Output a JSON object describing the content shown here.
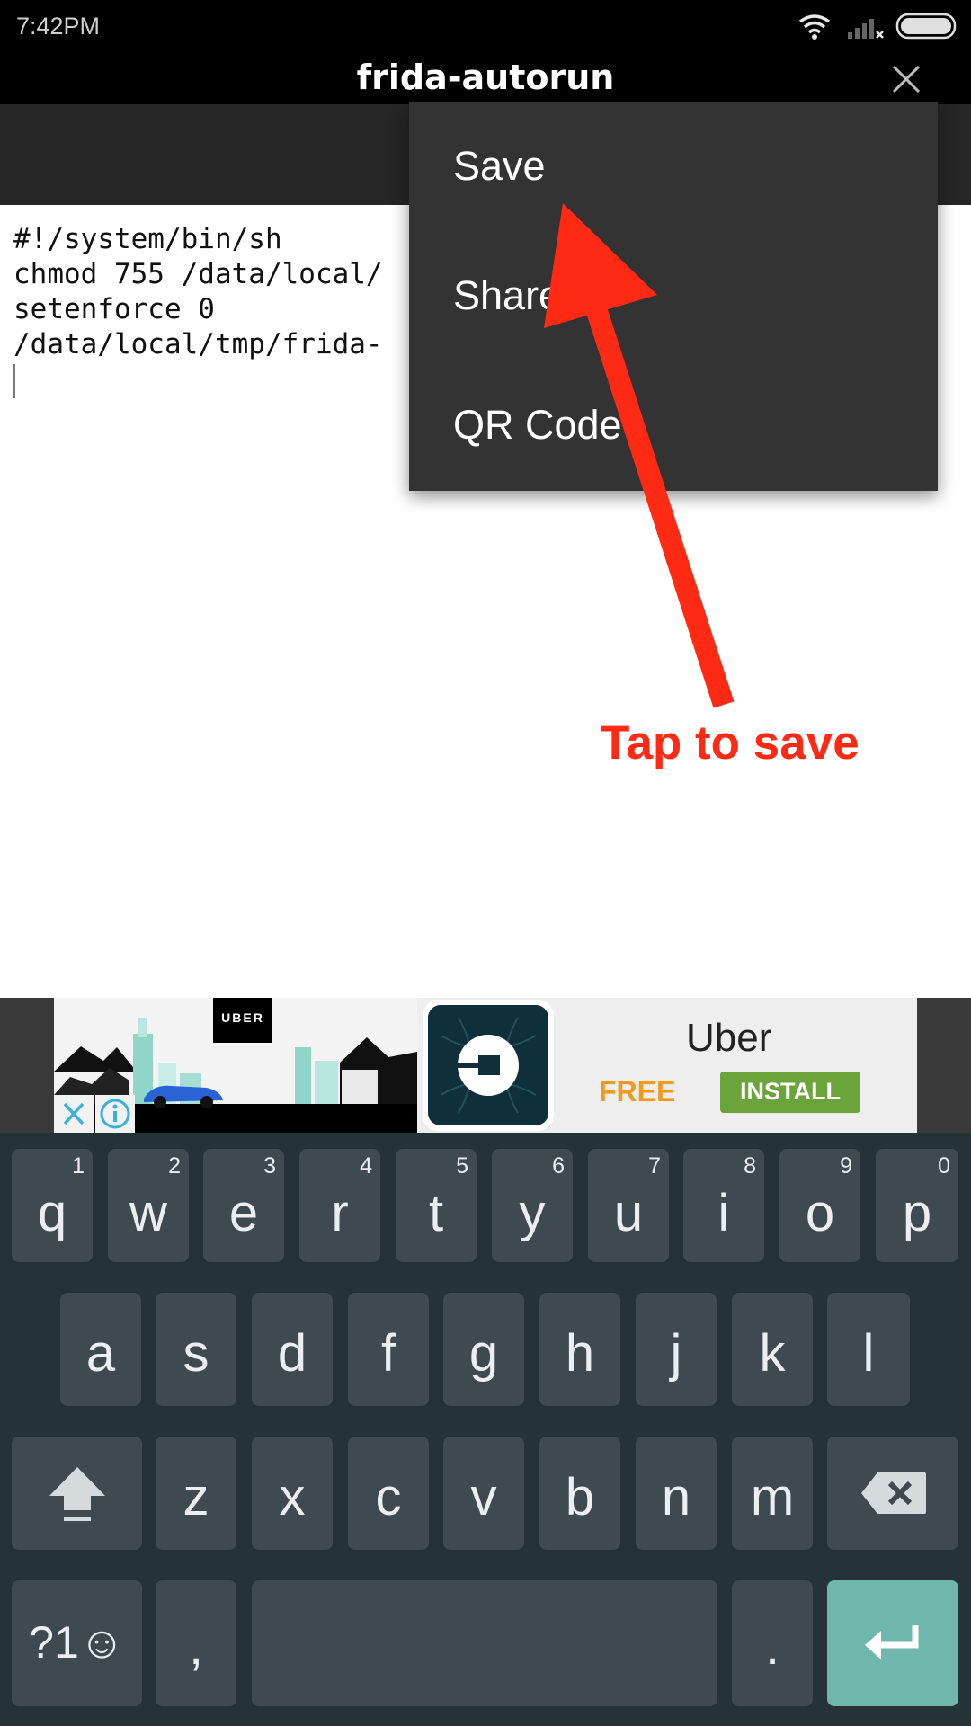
{
  "status_bar": {
    "time": "7:42PM",
    "icons": [
      "wifi-icon",
      "signal-icon",
      "battery-icon"
    ]
  },
  "title_bar": {
    "title": "frida-autorun",
    "close_icon": "close-icon"
  },
  "editor": {
    "lines": [
      "#!/system/bin/sh",
      "chmod 755 /data/local/",
      "setenforce 0",
      "/data/local/tmp/frida-"
    ]
  },
  "menu": {
    "items": [
      "Save",
      "Share",
      "QR Code"
    ]
  },
  "annotation": {
    "text": "Tap to save",
    "color": "#ff2a14"
  },
  "ad": {
    "brand_badge": "UBER",
    "app_name": "Uber",
    "price": "FREE",
    "install_label": "INSTALL",
    "colors": {
      "install": "#6aa43a",
      "free": "#f29a1f",
      "icon_bg": "#0f2f3a"
    }
  },
  "keyboard": {
    "row1": [
      {
        "label": "q",
        "hint": "1"
      },
      {
        "label": "w",
        "hint": "2"
      },
      {
        "label": "e",
        "hint": "3"
      },
      {
        "label": "r",
        "hint": "4"
      },
      {
        "label": "t",
        "hint": "5"
      },
      {
        "label": "y",
        "hint": "6"
      },
      {
        "label": "u",
        "hint": "7"
      },
      {
        "label": "i",
        "hint": "8"
      },
      {
        "label": "o",
        "hint": "9"
      },
      {
        "label": "p",
        "hint": "0"
      }
    ],
    "row2": [
      "a",
      "s",
      "d",
      "f",
      "g",
      "h",
      "j",
      "k",
      "l"
    ],
    "row3": [
      "z",
      "x",
      "c",
      "v",
      "b",
      "n",
      "m"
    ],
    "symbols_label": "?1☺",
    "comma": ",",
    "period": ".",
    "colors": {
      "background": "#253238",
      "key": "#3e4a50",
      "enter": "#6fb6ad"
    }
  }
}
